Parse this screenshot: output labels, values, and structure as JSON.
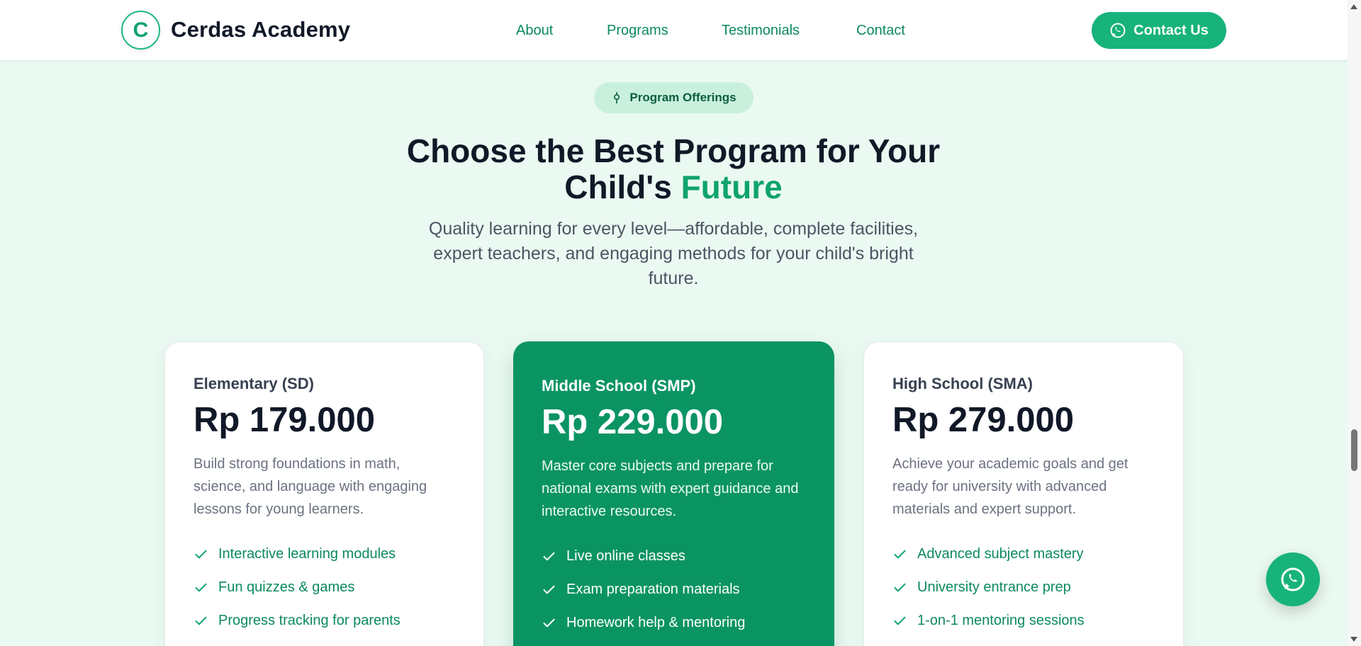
{
  "header": {
    "logo_letter": "C",
    "brand": "Cerdas Academy",
    "nav": [
      "About",
      "Programs",
      "Testimonials",
      "Contact"
    ],
    "cta_label": "Contact Us"
  },
  "hero": {
    "pill_label": "Program Offerings",
    "headline_main": "Choose the Best Program for Your Child's",
    "headline_accent": "Future",
    "subtext": "Quality learning for every level—affordable, complete facilities, expert teachers, and engaging methods for your child's bright future."
  },
  "programs": [
    {
      "tier": "Elementary (SD)",
      "price": "Rp 179.000",
      "description": "Build strong foundations in math, science, and language with engaging lessons for young learners.",
      "features": [
        "Interactive learning modules",
        "Fun quizzes & games",
        "Progress tracking for parents"
      ]
    },
    {
      "tier": "Middle School (SMP)",
      "price": "Rp 229.000",
      "description": "Master core subjects and prepare for national exams with expert guidance and interactive resources.",
      "features": [
        "Live online classes",
        "Exam preparation materials",
        "Homework help & mentoring"
      ]
    },
    {
      "tier": "High School (SMA)",
      "price": "Rp 279.000",
      "description": "Achieve your academic goals and get ready for university with advanced materials and expert support.",
      "features": [
        "Advanced subject mastery",
        "University entrance prep",
        "1-on-1 mentoring sessions"
      ]
    }
  ],
  "colors": {
    "accent": "#10a36d",
    "featured_card": "#0b9463",
    "page_bg": "#eafaf2",
    "cta": "#17b37b"
  },
  "icons": {
    "cta": "whatsapp-icon",
    "pill": "pin-icon",
    "feature": "check-icon",
    "fab": "whatsapp-icon"
  }
}
